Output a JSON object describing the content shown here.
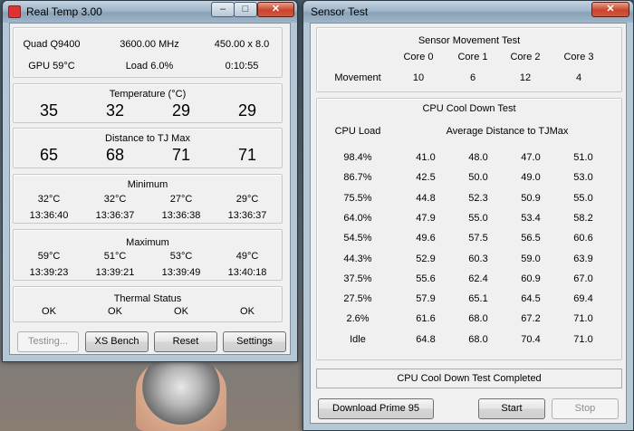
{
  "rt": {
    "title": "Real Temp 3.00",
    "cpu": "Quad Q9400",
    "mhz": "3600.00 MHz",
    "mult": "450.00 x 8.0",
    "gpu": "GPU  59°C",
    "load": "Load   6.0%",
    "time": "0:10:55",
    "temp_label": "Temperature (°C)",
    "temps": [
      "35",
      "32",
      "29",
      "29"
    ],
    "dist_label": "Distance to TJ Max",
    "dists": [
      "65",
      "68",
      "71",
      "71"
    ],
    "min_label": "Minimum",
    "min_t": [
      "32°C",
      "32°C",
      "27°C",
      "29°C"
    ],
    "min_time": [
      "13:36:40",
      "13:36:37",
      "13:36:38",
      "13:36:37"
    ],
    "max_label": "Maximum",
    "max_t": [
      "59°C",
      "51°C",
      "53°C",
      "49°C"
    ],
    "max_time": [
      "13:39:23",
      "13:39:21",
      "13:39:49",
      "13:40:18"
    ],
    "thermal_label": "Thermal Status",
    "status": [
      "OK",
      "OK",
      "OK",
      "OK"
    ],
    "buttons": [
      "Testing...",
      "XS Bench",
      "Reset",
      "Settings"
    ]
  },
  "st": {
    "title": "Sensor Test",
    "move_label": "Sensor Movement Test",
    "cores": [
      "Core 0",
      "Core 1",
      "Core 2",
      "Core 3"
    ],
    "movement": "Movement",
    "move_vals": [
      "10",
      "6",
      "12",
      "4"
    ],
    "cool_label": "CPU Cool Down Test",
    "cpu_load": "CPU Load",
    "avg_label": "Average Distance to TJMax",
    "rows": [
      [
        "98.4%",
        "41.0",
        "48.0",
        "47.0",
        "51.0"
      ],
      [
        "86.7%",
        "42.5",
        "50.0",
        "49.0",
        "53.0"
      ],
      [
        "75.5%",
        "44.8",
        "52.3",
        "50.9",
        "55.0"
      ],
      [
        "64.0%",
        "47.9",
        "55.0",
        "53.4",
        "58.2"
      ],
      [
        "54.5%",
        "49.6",
        "57.5",
        "56.5",
        "60.6"
      ],
      [
        "44.3%",
        "52.9",
        "60.3",
        "59.0",
        "63.9"
      ],
      [
        "37.5%",
        "55.6",
        "62.4",
        "60.9",
        "67.0"
      ],
      [
        "27.5%",
        "57.9",
        "65.1",
        "64.5",
        "69.4"
      ],
      [
        "2.6%",
        "61.6",
        "68.0",
        "67.2",
        "71.0"
      ],
      [
        "Idle",
        "64.8",
        "68.0",
        "70.4",
        "71.0"
      ]
    ],
    "complete": "CPU Cool Down Test Completed",
    "buttons": [
      "Download Prime 95",
      "Start",
      "Stop"
    ]
  },
  "win_controls": {
    "minimize": "–",
    "maximize": "□",
    "close": "✕"
  }
}
